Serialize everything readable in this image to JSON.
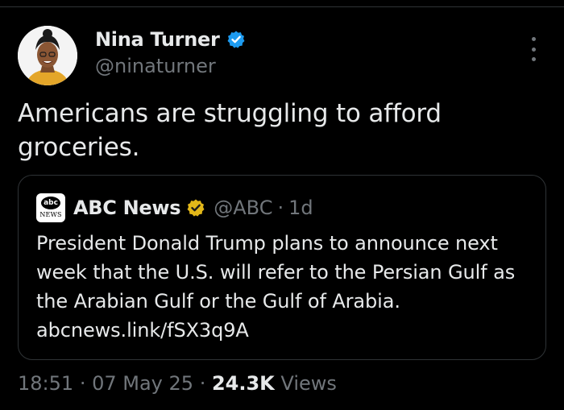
{
  "author": {
    "display_name": "Nina Turner",
    "handle": "@ninaturner",
    "verified": true
  },
  "tweet": {
    "text": "Americans are struggling to afford groceries."
  },
  "quoted_tweet": {
    "source_logo_text": "abc",
    "source_logo_sub": "NEWS",
    "display_name": "ABC News",
    "handle": "@ABC",
    "separator": "·",
    "age": "1d",
    "text": "President Donald Trump plans to announce next week that the U.S. will refer to the Persian Gulf as the Arabian Gulf or the Gulf of Arabia.",
    "link": "abcnews.link/fSX3q9A"
  },
  "meta": {
    "time": "18:51",
    "sep1": "·",
    "date": "07 May 25",
    "sep2": "·",
    "views_count": "24.3K",
    "views_label": "Views"
  },
  "icons": {
    "verified_badge": "verified-badge-icon",
    "gold_badge": "gold-verified-badge-icon",
    "more": "more-vertical-icon"
  },
  "colors": {
    "background": "#000000",
    "primary_text": "#e7e9ea",
    "secondary_text": "#71767b",
    "verified_blue": "#1d9bf0",
    "verified_gold": "#e2b719",
    "border": "#2f3336"
  }
}
